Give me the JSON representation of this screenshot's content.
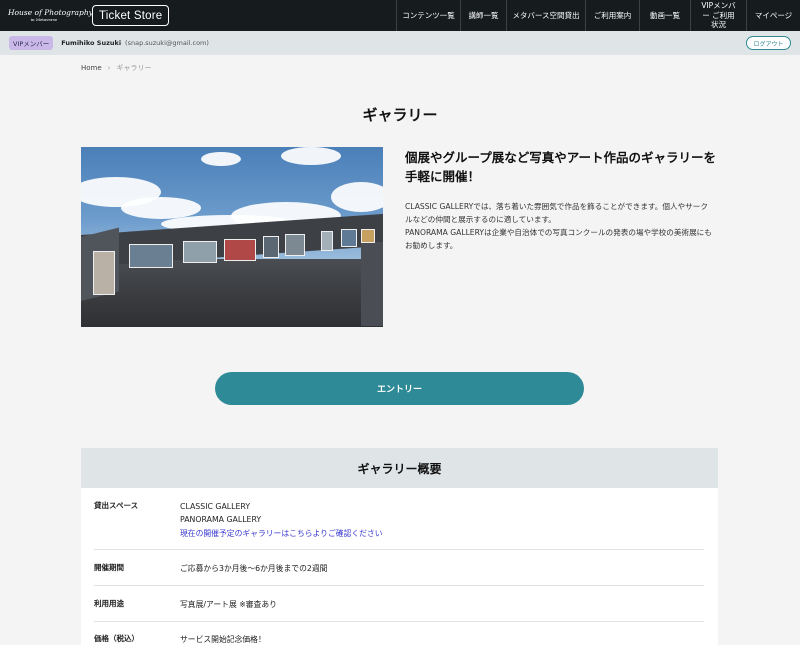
{
  "header": {
    "logo_line1": "House of Photography",
    "logo_line2": "in Metaverse",
    "store_name": "Ticket Store",
    "nav": [
      {
        "label": "コンテンツ一覧"
      },
      {
        "label": "講師一覧"
      },
      {
        "label": "メタバース空間貸出"
      },
      {
        "label": "ご利用案内"
      },
      {
        "label": "動画一覧"
      },
      {
        "label": "VIPメンバー ご利用状況"
      },
      {
        "label": "マイページ"
      }
    ]
  },
  "userbar": {
    "badge": "VIPメンバー",
    "name": "Fumihiko Suzuki",
    "email": "(snap.suzuki@gmail.com)",
    "logout": "ログアウト"
  },
  "breadcrumb": {
    "home": "Home",
    "sep": "›",
    "current": "ギャラリー"
  },
  "page": {
    "title": "ギャラリー",
    "tagline": "個展やグループ展など写真やアート作品のギャラリーを手軽に開催！",
    "desc1": "CLASSIC GALLERYでは、落ち着いた雰囲気で作品を飾ることができます。個人やサークルなどの仲間と展示するのに適しています。",
    "desc2": "PANORAMA GALLERYは企業や自治体での写真コンクールの発表の場や学校の美術展にもお勧めします。",
    "entry_button": "エントリー"
  },
  "overview": {
    "heading": "ギャラリー概要",
    "rows": [
      {
        "label": "貸出スペース",
        "line1": "CLASSIC GALLERY",
        "line2": "PANORAMA GALLERY",
        "link": "現在の開催予定のギャラリーはこちらよりご確認ください"
      },
      {
        "label": "開催期間",
        "value": "ご応募から3か月後〜6か月後までの2週間"
      },
      {
        "label": "利用用途",
        "value": "写真展/アート展 ※審査あり"
      },
      {
        "label": "価格（税込）",
        "value": "サービス開始記念価格！"
      }
    ]
  }
}
